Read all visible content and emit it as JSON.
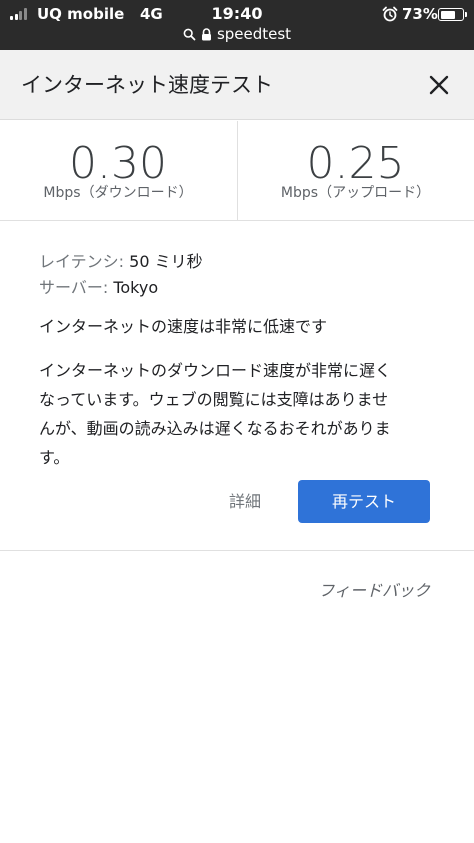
{
  "status_bar": {
    "carrier": "UQ mobile",
    "network": "4G",
    "time": "19:40",
    "battery_percent": "73%",
    "battery_level": 0.73,
    "url": "speedtest"
  },
  "header": {
    "title": "インターネット速度テスト"
  },
  "results": {
    "download": {
      "value": "0.30",
      "unit": "Mbps（ダウンロード）"
    },
    "upload": {
      "value": "0.25",
      "unit": "Mbps（アップロード）"
    }
  },
  "info": {
    "latency_label": "レイテンシ:",
    "latency_value": "50 ミリ秒",
    "server_label": "サーバー:",
    "server_value": "Tokyo"
  },
  "message": {
    "headline": "インターネットの速度は非常に低速です",
    "body_line1": "インターネットのダウンロード速度が非常に遅く",
    "body_line2": "なっています。ウェブの閲覧には支障はありませ",
    "body_line3": "んが、動画の読み込みは遅くなるおそれがありま",
    "body_line4": "す。"
  },
  "actions": {
    "details_label": "詳細",
    "retest_label": "再テスト"
  },
  "footer": {
    "feedback_label": "フィードバック"
  },
  "colors": {
    "accent": "#2f73d8",
    "status_bar_bg": "#2b2b2b",
    "header_bg": "#f1f1f1"
  }
}
